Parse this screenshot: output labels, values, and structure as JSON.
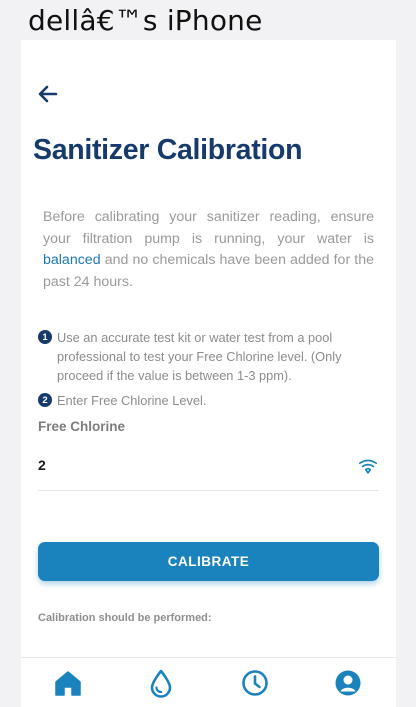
{
  "device": {
    "label": "dellâ€™s iPhone"
  },
  "header": {
    "back_icon": "arrow-left-icon",
    "title": "Sanitizer Calibration"
  },
  "intro": {
    "text_before": "Before calibrating your sanitizer reading, ensure your filtration pump is running, your water is ",
    "link": "balanced",
    "text_after": " and no chemicals have been added for the past 24 hours."
  },
  "steps": [
    {
      "number": "1",
      "text": "Use an accurate test kit or water test from a pool professional to test your Free Chlorine level. (Only proceed if the value is between 1-3 ppm)."
    },
    {
      "number": "2",
      "text": "Enter Free Chlorine Level."
    }
  ],
  "field": {
    "label": "Free Chlorine",
    "value": "2",
    "icon": "test-strip-icon"
  },
  "calibrate_label": "CALIBRATE",
  "note": "Calibration should be performed:",
  "tabbar": {
    "icons": [
      "home-icon",
      "water-drop-icon",
      "clock-icon",
      "profile-icon"
    ]
  },
  "colors": {
    "primary": "#173a6c",
    "accent": "#1a83be",
    "link": "#1d78b4"
  }
}
